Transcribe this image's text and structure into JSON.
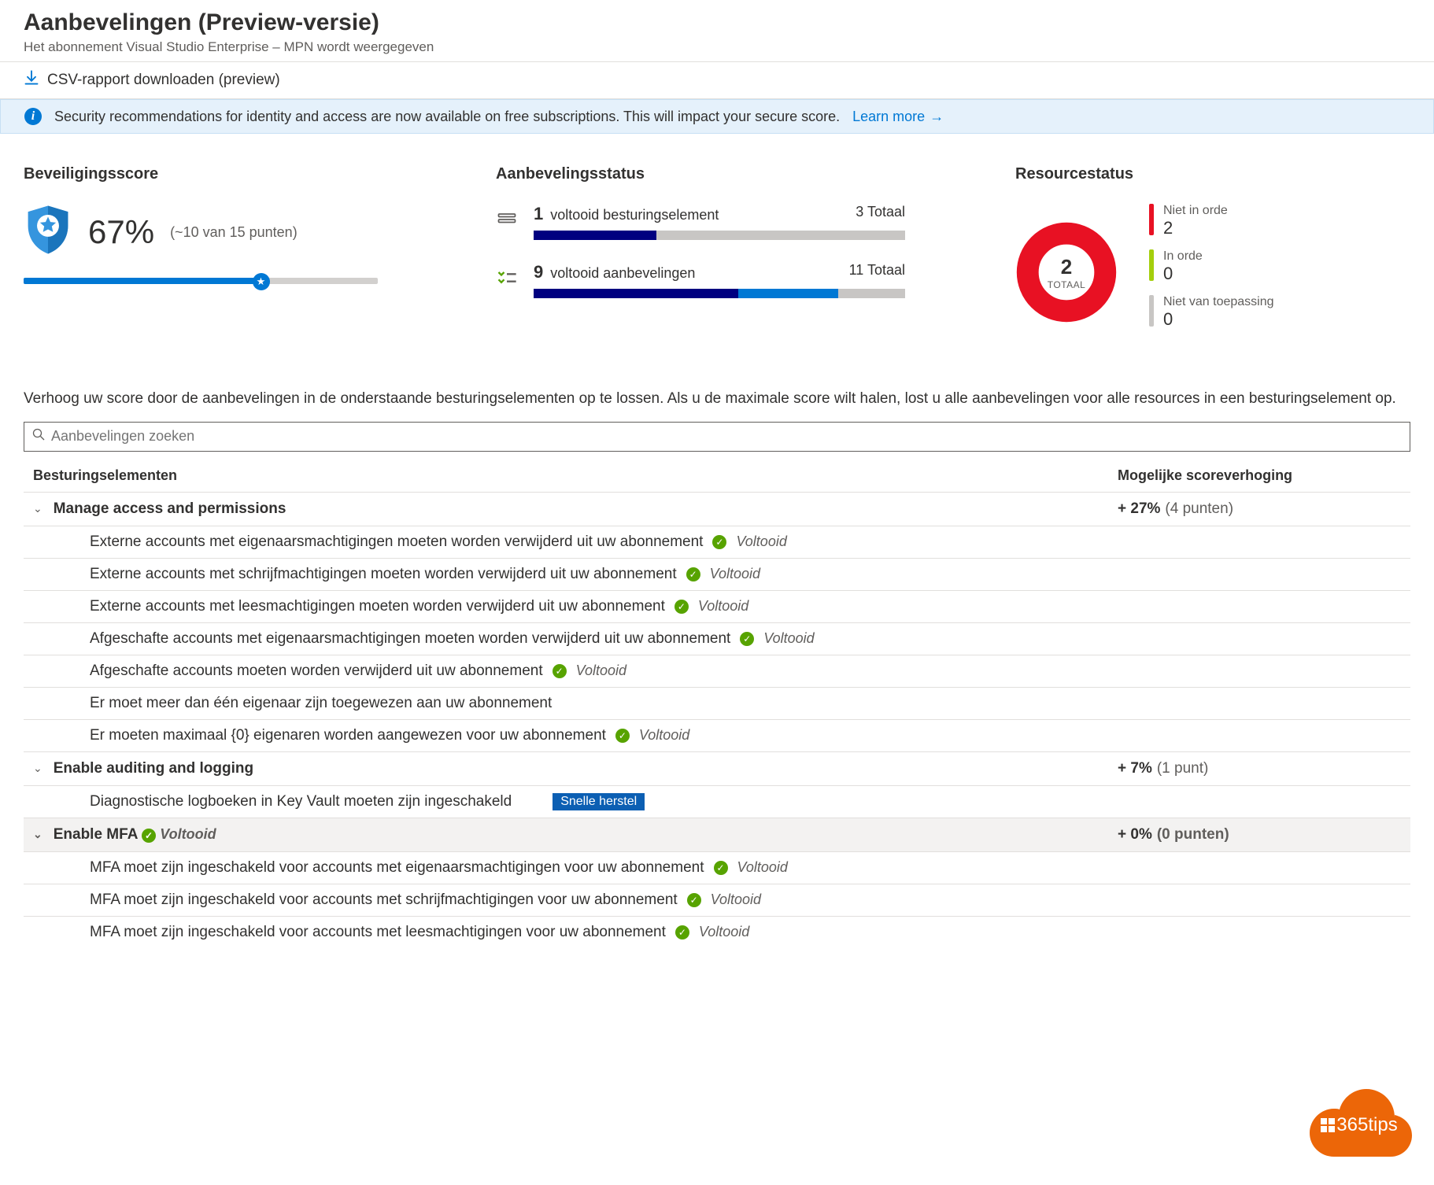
{
  "header": {
    "title": "Aanbevelingen (Preview-versie)",
    "subtitle": "Het abonnement Visual Studio Enterprise – MPN wordt weergegeven"
  },
  "toolbar": {
    "download_label": "CSV-rapport downloaden (preview)"
  },
  "infobar": {
    "text": "Security recommendations for identity and access are now available on free subscriptions. This will impact your secure score.",
    "learn_more_label": "Learn more"
  },
  "score": {
    "title": "Beveiligingsscore",
    "percent": "67%",
    "detail": "(~10 van 15 punten)",
    "fill_percent": 67
  },
  "recstatus": {
    "title": "Aanbevelingsstatus",
    "rows": [
      {
        "done": "1",
        "label": "voltooid besturingselement",
        "total_label": "3 Totaal",
        "seg1": 33,
        "seg2": 0
      },
      {
        "done": "9",
        "label": "voltooid aanbevelingen",
        "total_label": "11 Totaal",
        "seg1": 55,
        "seg2": 27
      }
    ]
  },
  "resstatus": {
    "title": "Resourcestatus",
    "center_num": "2",
    "center_label": "TOTAAL",
    "legend": [
      {
        "label": "Niet in orde",
        "value": "2",
        "color": "#e81123"
      },
      {
        "label": "In orde",
        "value": "0",
        "color": "#a4cf0c"
      },
      {
        "label": "Niet van toepassing",
        "value": "0",
        "color": "#c8c6c4"
      }
    ]
  },
  "helper_text": "Verhoog uw score door de aanbevelingen in de onderstaande besturingselementen op te lossen. Als u de maximale score wilt halen, lost u alle aanbevelingen voor alle resources in een besturingselement op.",
  "search": {
    "placeholder": "Aanbevelingen zoeken"
  },
  "thead": {
    "c1": "Besturingselementen",
    "c2": "Mogelijke scoreverhoging"
  },
  "status_completed": "Voltooid",
  "groups": [
    {
      "name": "Manage access and permissions",
      "score": "+ 27%",
      "score_sub": "(4 punten)",
      "expanded": true,
      "completed": false,
      "highlight": false,
      "items": [
        {
          "text": "Externe accounts met eigenaarsmachtigingen moeten worden verwijderd uit uw abonnement",
          "completed": true
        },
        {
          "text": "Externe accounts met schrijfmachtigingen moeten worden verwijderd uit uw abonnement",
          "completed": true
        },
        {
          "text": "Externe accounts met leesmachtigingen moeten worden verwijderd uit uw abonnement",
          "completed": true
        },
        {
          "text": "Afgeschafte accounts met eigenaarsmachtigingen moeten worden verwijderd uit uw abonnement",
          "completed": true
        },
        {
          "text": "Afgeschafte accounts moeten worden verwijderd uit uw abonnement",
          "completed": true
        },
        {
          "text": "Er moet meer dan één eigenaar zijn toegewezen aan uw abonnement",
          "completed": false
        },
        {
          "text": "Er moeten maximaal {0} eigenaren worden aangewezen voor uw abonnement",
          "completed": true
        }
      ]
    },
    {
      "name": "Enable auditing and logging",
      "score": "+ 7%",
      "score_sub": "(1 punt)",
      "expanded": true,
      "completed": false,
      "highlight": false,
      "items": [
        {
          "text": "Diagnostische logboeken in Key Vault moeten zijn ingeschakeld",
          "completed": false,
          "badge": "Snelle herstel"
        }
      ]
    },
    {
      "name": "Enable MFA",
      "score": "+ 0%",
      "score_sub": "(0 punten)",
      "expanded": true,
      "completed": true,
      "highlight": true,
      "items": [
        {
          "text": "MFA moet zijn ingeschakeld voor accounts met eigenaarsmachtigingen voor uw abonnement",
          "completed": true
        },
        {
          "text": "MFA moet zijn ingeschakeld voor accounts met schrijfmachtigingen voor uw abonnement",
          "completed": true
        },
        {
          "text": "MFA moet zijn ingeschakeld voor accounts met leesmachtigingen voor uw abonnement",
          "completed": true
        }
      ]
    }
  ],
  "logo": {
    "text": "365tips"
  }
}
